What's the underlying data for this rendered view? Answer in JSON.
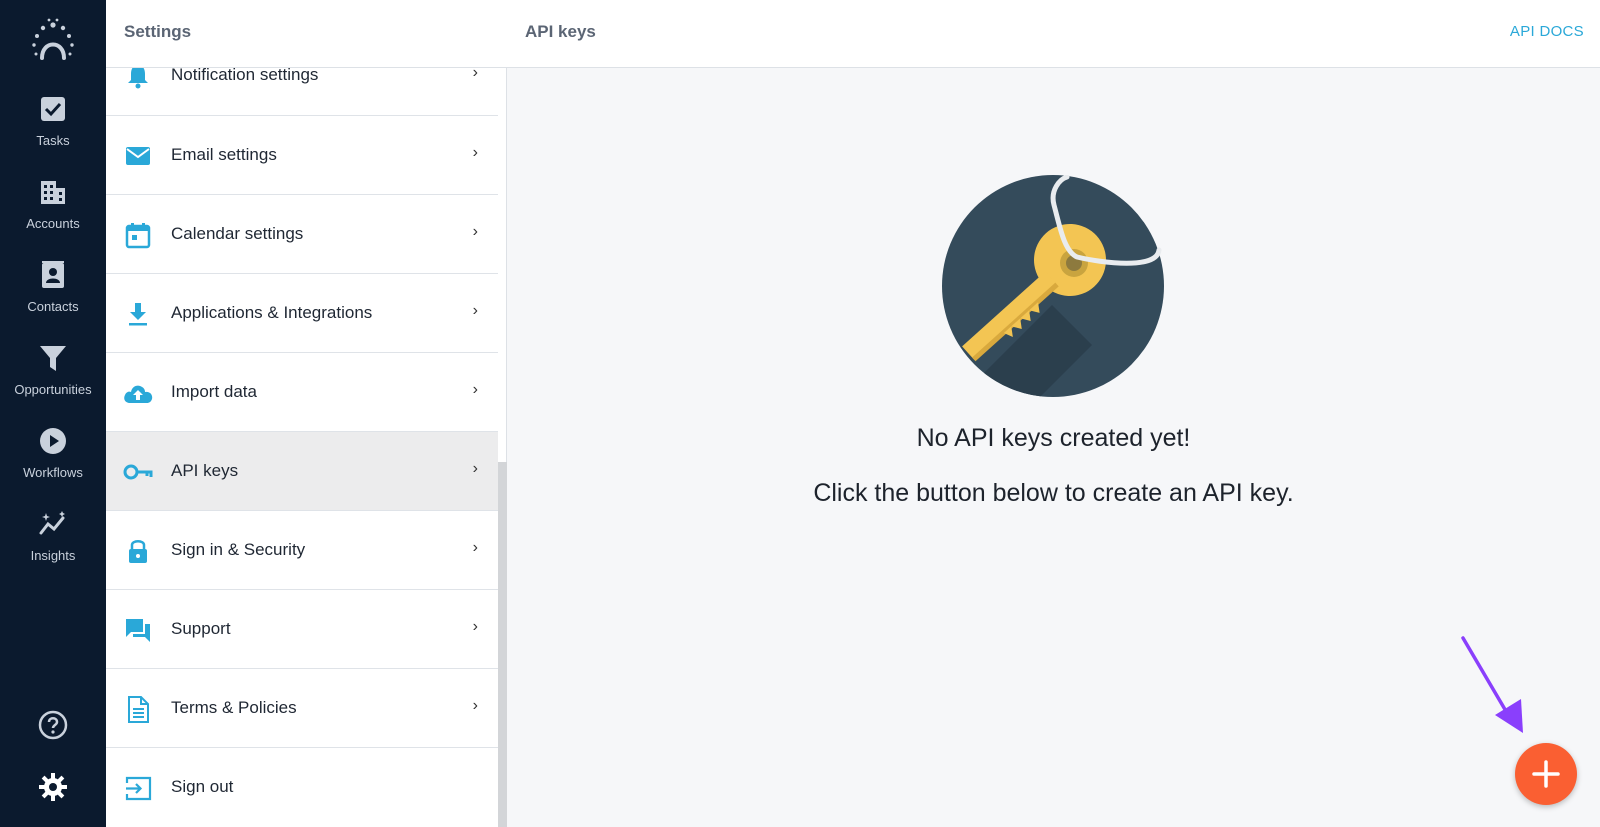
{
  "colors": {
    "rail_bg": "#0b1a2e",
    "accent_blue": "#2aa8d8",
    "fab": "#fa5f32",
    "key": "#f3c553",
    "circle": "#344b5b"
  },
  "rail": {
    "items": [
      {
        "label": "Tasks",
        "icon": "check-square-icon"
      },
      {
        "label": "Accounts",
        "icon": "building-icon"
      },
      {
        "label": "Contacts",
        "icon": "contact-card-icon"
      },
      {
        "label": "Opportunities",
        "icon": "funnel-icon"
      },
      {
        "label": "Workflows",
        "icon": "play-circle-icon"
      },
      {
        "label": "Insights",
        "icon": "sparkle-chart-icon"
      }
    ],
    "help_icon": "help-circle-icon",
    "settings_icon": "gear-icon"
  },
  "settings": {
    "title": "Settings",
    "items": [
      {
        "label": "Notification settings",
        "icon": "bell-icon"
      },
      {
        "label": "Email settings",
        "icon": "envelope-icon"
      },
      {
        "label": "Calendar settings",
        "icon": "calendar-icon"
      },
      {
        "label": "Applications & Integrations",
        "icon": "download-icon"
      },
      {
        "label": "Import data",
        "icon": "cloud-upload-icon"
      },
      {
        "label": "API keys",
        "icon": "key-icon",
        "active": true
      },
      {
        "label": "Sign in & Security",
        "icon": "lock-icon"
      },
      {
        "label": "Support",
        "icon": "chat-icon"
      },
      {
        "label": "Terms & Policies",
        "icon": "document-icon"
      },
      {
        "label": "Sign out",
        "icon": "sign-out-icon"
      }
    ],
    "chevron": "›"
  },
  "main": {
    "title": "API keys",
    "docs_link": "API DOCS",
    "empty_title": "No API keys created yet!",
    "empty_subtitle": "Click the button below to create an API key.",
    "fab_icon": "plus-icon"
  }
}
